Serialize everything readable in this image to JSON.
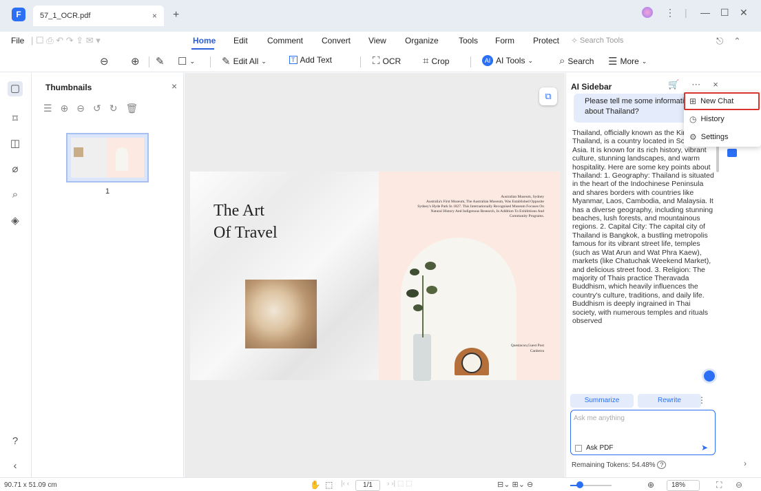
{
  "titlebar": {
    "app_logo": "F",
    "tab_name": "57_1_OCR.pdf",
    "tab_close": "×",
    "new_tab": "+",
    "controls": [
      "⋮",
      "|",
      "—",
      "☐",
      "✕"
    ]
  },
  "menu": {
    "file": "File",
    "items": [
      "Home",
      "Edit",
      "Comment",
      "Convert",
      "View",
      "Organize",
      "Tools",
      "Form",
      "Protect"
    ],
    "search_tools": "Search Tools"
  },
  "toolbar": {
    "edit_all": "Edit All",
    "add_text": "Add Text",
    "ocr": "OCR",
    "crop": "Crop",
    "ai_tools": "AI Tools",
    "search": "Search",
    "more": "More"
  },
  "thumbnails": {
    "title": "Thumbnails",
    "page_label": "1"
  },
  "document": {
    "title_line1": "The Art",
    "title_line2": "Of Travel",
    "museum_text": "Australian Museum, Sydney\nAustralia's First Museum, The Australian Museum, Was Established Opposite Sydney's Hyde Park In 1827. This Internationally Recognised Museum Focuses On Natural History And Indigenous Research, In Addition To Exhibitions And Community Programs.",
    "queue_text": "Questacon,Guest Post\nCanberra"
  },
  "ai_sidebar": {
    "title": "AI Sidebar",
    "user_message": "Please tell me some information about Thailand?",
    "response": "Thailand, officially known as the Kingdom of Thailand, is a country located in Southeast Asia. It is known for its rich history, vibrant culture, stunning landscapes, and warm hospitality. Here are some key points about Thailand: 1. Geography: Thailand is situated in the heart of the Indochinese Peninsula and shares borders with countries like Myanmar, Laos, Cambodia, and Malaysia. It has a diverse geography, including stunning beaches, lush forests, and mountainous regions. 2. Capital City: The capital city of Thailand is Bangkok, a bustling metropolis famous for its vibrant street life, temples (such as Wat Arun and Wat Phra Kaew), markets (like Chatuchak Weekend Market), and delicious street food. 3. Religion: The majority of Thais practice Theravada Buddhism, which heavily influences the country's culture, traditions, and daily life. Buddhism is deeply ingrained in Thai society, with numerous temples and rituals observed",
    "summarize": "Summarize",
    "rewrite": "Rewrite",
    "ask_placeholder": "Ask me anything",
    "ask_pdf": "Ask PDF",
    "tokens": "Remaining Tokens: 54.48%"
  },
  "dropdown": {
    "items": [
      "New Chat",
      "History",
      "Settings"
    ]
  },
  "statusbar": {
    "dimensions": "90.71 x 51.09 cm",
    "page": "1/1",
    "zoom": "18%"
  },
  "colors": {
    "accent": "#2b6ff4",
    "highlight": "#d9342b"
  }
}
